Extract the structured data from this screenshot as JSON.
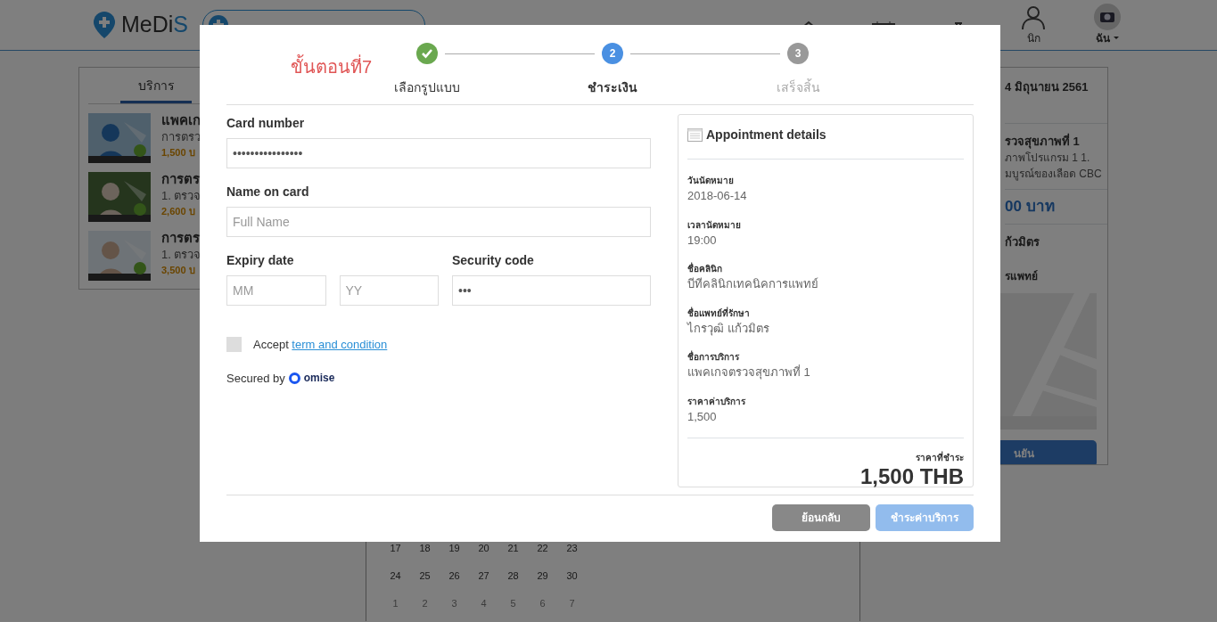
{
  "header": {
    "logo_prefix": "MeDi",
    "logo_suffix": "S",
    "nav_labels": [
      "นิก",
      "ฉัน"
    ]
  },
  "services": {
    "tab": "บริการ",
    "items": [
      {
        "title": "แพคเก",
        "subtitle": "การตรว",
        "price": "1,500 บ"
      },
      {
        "title": "การตร",
        "subtitle": "1. ตรวจ",
        "price": "2,600 บ"
      },
      {
        "title": "การตร",
        "subtitle": "1. ตรวจ",
        "price": "3,500 บ"
      }
    ]
  },
  "calendar": {
    "weeks": [
      [
        "17",
        "18",
        "19",
        "20",
        "21",
        "22",
        "23"
      ],
      [
        "24",
        "25",
        "26",
        "27",
        "28",
        "29",
        "30"
      ],
      [
        "1",
        "2",
        "3",
        "4",
        "5",
        "6",
        "7"
      ]
    ]
  },
  "summary": {
    "date": "4 มิถุนายน 2561",
    "service_title": "รวจสุขภาพที่ 1",
    "service_lines": [
      "ภาพโปรแกรม 1 1.",
      "มบูรณ์ของเลือด CBC"
    ],
    "price": "00 บาท",
    "doctor": "ก้วมิตร",
    "clinic_heading": "รแพทย์",
    "confirm_button": "นยัน"
  },
  "modal": {
    "step_caption": "ขั้นตอนที่7",
    "steps": [
      {
        "label": "เลือกรูปแบบ",
        "done": true,
        "selected": false
      },
      {
        "number": "2",
        "label": "ชำระเงิน",
        "done": false,
        "selected": true
      },
      {
        "number": "3",
        "label": "เสร็จสิ้น",
        "done": false,
        "selected": false
      }
    ],
    "form": {
      "card_number": {
        "label": "Card number",
        "value": "••••••••••••••••"
      },
      "name": {
        "label": "Name on card",
        "placeholder": "Full Name"
      },
      "expiry": {
        "label": "Expiry date",
        "month_placeholder": "MM",
        "year_placeholder": "YY"
      },
      "security": {
        "label": "Security code",
        "value": "•••"
      },
      "accept": {
        "text": "Accept",
        "link": "term and condition",
        "checked": false
      },
      "secured": {
        "text": "Secured by",
        "brand": "omise"
      }
    },
    "details": {
      "title": "Appointment details",
      "fields": [
        {
          "label": "วันนัดหมาย",
          "value": "2018-06-14"
        },
        {
          "label": "เวลานัดหมาย",
          "value": "19:00"
        },
        {
          "label": "ชื่อคลินิก",
          "value": "บีทีคลินิกเทคนิคการแพทย์"
        },
        {
          "label": "ชื่อแพทย์ที่รักษา",
          "value": "ไกรวุฒิ แก้วมิตร"
        },
        {
          "label": "ชื่อการบริการ",
          "value": "แพคเกจตรวจสุขภาพที่ 1"
        },
        {
          "label": "ราคาค่าบริการ",
          "value": "1,500"
        }
      ],
      "total_label": "ราคาที่ชำระ",
      "total": "1,500 THB"
    },
    "buttons": [
      {
        "label": "ย้อนกลับ",
        "kind": "secondary",
        "disabled": false
      },
      {
        "label": "ชำระค่าบริการ",
        "kind": "primary",
        "disabled": true
      }
    ]
  }
}
